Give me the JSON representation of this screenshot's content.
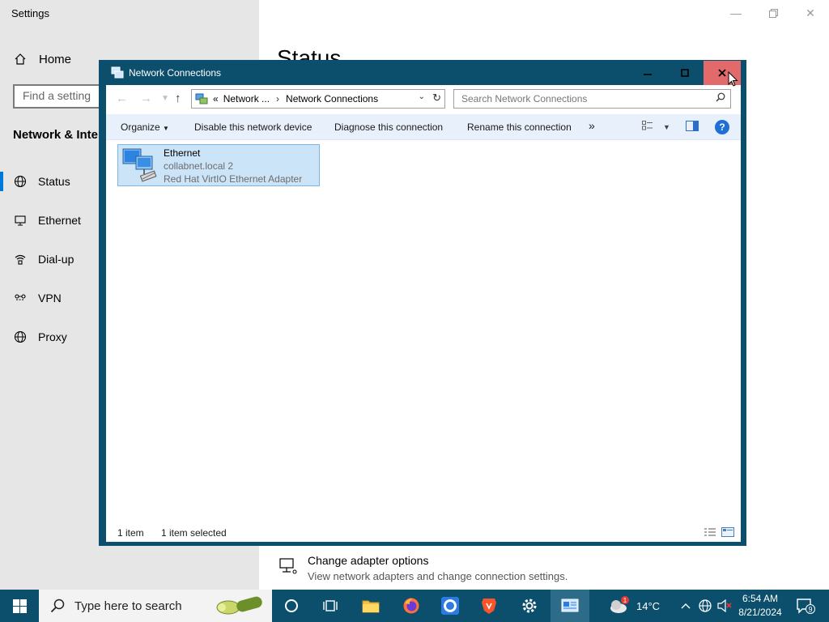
{
  "settings": {
    "title": "Settings",
    "home_label": "Home",
    "find_placeholder": "Find a setting",
    "section_title": "Network & Internet",
    "nav_items": [
      {
        "label": "Status",
        "icon": "globe-icon"
      },
      {
        "label": "Ethernet",
        "icon": "ethernet-icon"
      },
      {
        "label": "Dial-up",
        "icon": "dialup-icon"
      },
      {
        "label": "VPN",
        "icon": "vpn-icon"
      },
      {
        "label": "Proxy",
        "icon": "globe-icon"
      }
    ],
    "active_item": "Status",
    "page_title": "Status",
    "adapter_options": {
      "title": "Change adapter options",
      "subtitle": "View network adapters and change connection settings."
    }
  },
  "network_connections": {
    "title": "Network Connections",
    "breadcrumb": [
      "Network ...",
      "Network Connections"
    ],
    "breadcrumb_prefix": "«",
    "search_placeholder": "Search Network Connections",
    "commands": {
      "organize": "Organize",
      "disable": "Disable this network device",
      "diagnose": "Diagnose this connection",
      "rename": "Rename this connection",
      "more": "»"
    },
    "items": [
      {
        "name": "Ethernet",
        "network": "collabnet.local 2",
        "adapter": "Red Hat VirtIO Ethernet Adapter",
        "selected": true
      }
    ],
    "status": {
      "count": "1 item",
      "selection": "1 item selected"
    }
  },
  "taskbar": {
    "search_placeholder": "Type here to search",
    "weather": {
      "temp": "14°C",
      "alert_count": "1"
    },
    "time": "6:54 AM",
    "date": "8/21/2024",
    "notification_count": "9"
  },
  "colors": {
    "window_border": "#0b4f6c",
    "close_hover": "#e36a6a",
    "command_bar": "#e8f1fb",
    "selection": "#cce4f7",
    "accent": "#0078d7"
  }
}
